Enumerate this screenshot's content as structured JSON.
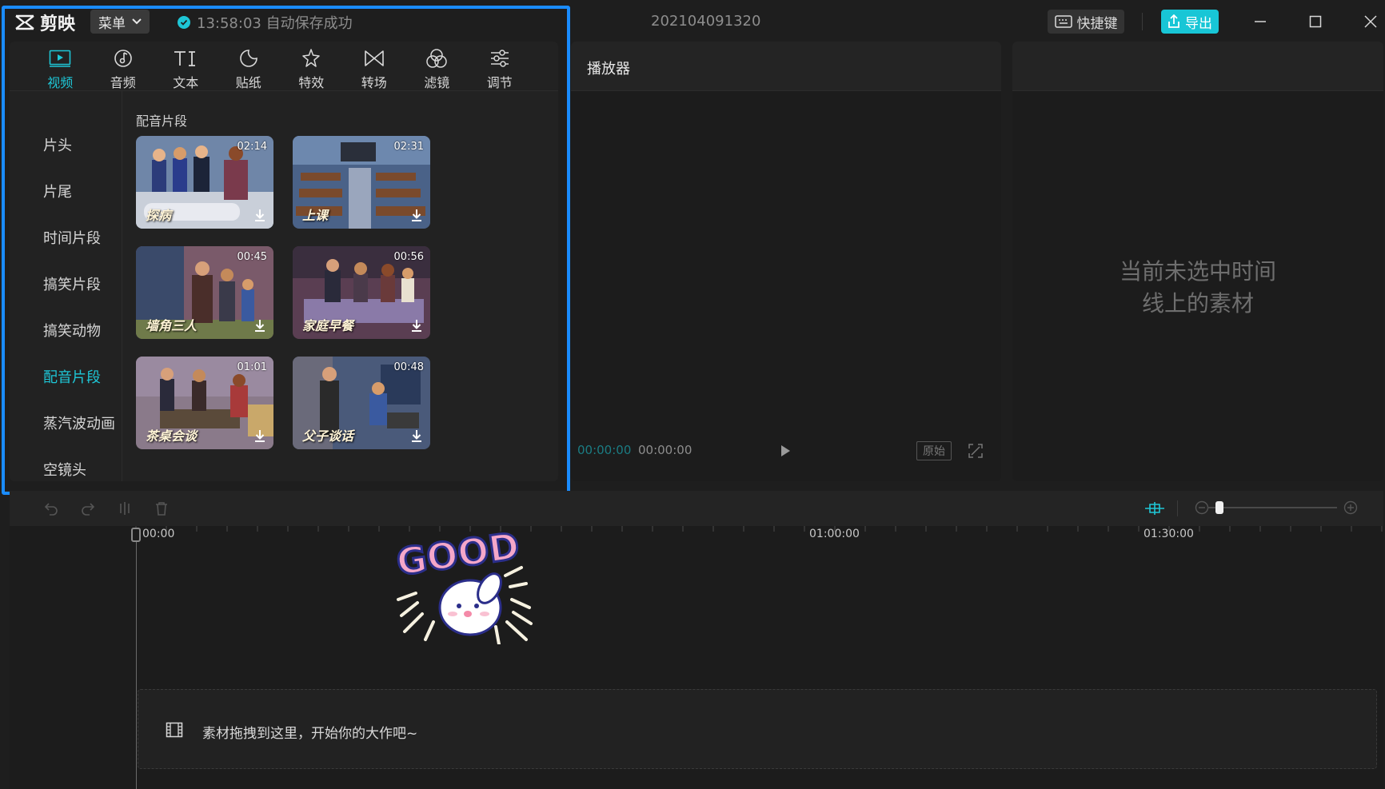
{
  "app": {
    "name": "剪映",
    "menu_label": "菜单",
    "autosave_text": "13:58:03 自动保存成功",
    "project_title": "202104091320",
    "shortcut_label": "快捷键",
    "export_label": "导出"
  },
  "media": {
    "tabs": [
      {
        "label": "视频",
        "icon": "video-icon",
        "active": true
      },
      {
        "label": "音频",
        "icon": "audio-icon"
      },
      {
        "label": "文本",
        "icon": "text-icon"
      },
      {
        "label": "贴纸",
        "icon": "sticker-icon"
      },
      {
        "label": "特效",
        "icon": "effects-icon"
      },
      {
        "label": "转场",
        "icon": "transition-icon"
      },
      {
        "label": "滤镜",
        "icon": "filter-icon"
      },
      {
        "label": "调节",
        "icon": "adjust-icon"
      }
    ],
    "categories": [
      "片头",
      "片尾",
      "时间片段",
      "搞笑片段",
      "搞笑动物",
      "配音片段",
      "蒸汽波动画",
      "空镜头"
    ],
    "active_category": "配音片段",
    "section_title": "配音片段",
    "clips": [
      {
        "name": "探病",
        "duration": "02:14"
      },
      {
        "name": "上课",
        "duration": "02:31"
      },
      {
        "name": "墙角三人",
        "duration": "00:45"
      },
      {
        "name": "家庭早餐",
        "duration": "00:56"
      },
      {
        "name": "茶桌会谈",
        "duration": "01:01"
      },
      {
        "name": "父子谈话",
        "duration": "00:48"
      }
    ]
  },
  "player": {
    "title": "播放器",
    "time_current": "00:00:00",
    "time_total": "00:00:00",
    "original_label": "原始"
  },
  "inspector": {
    "empty_line1": "当前未选中时间",
    "empty_line2": "线上的素材"
  },
  "timeline": {
    "ruler_labels": [
      "00:00",
      "01:00:00",
      "01:30:00"
    ],
    "drop_text": "素材拖拽到这里，开始你的大作吧~",
    "sticker_text": "GOOD"
  },
  "colors": {
    "accent": "#1ec6d6",
    "highlight": "#1a8cff",
    "background": "#1e1e1e"
  }
}
